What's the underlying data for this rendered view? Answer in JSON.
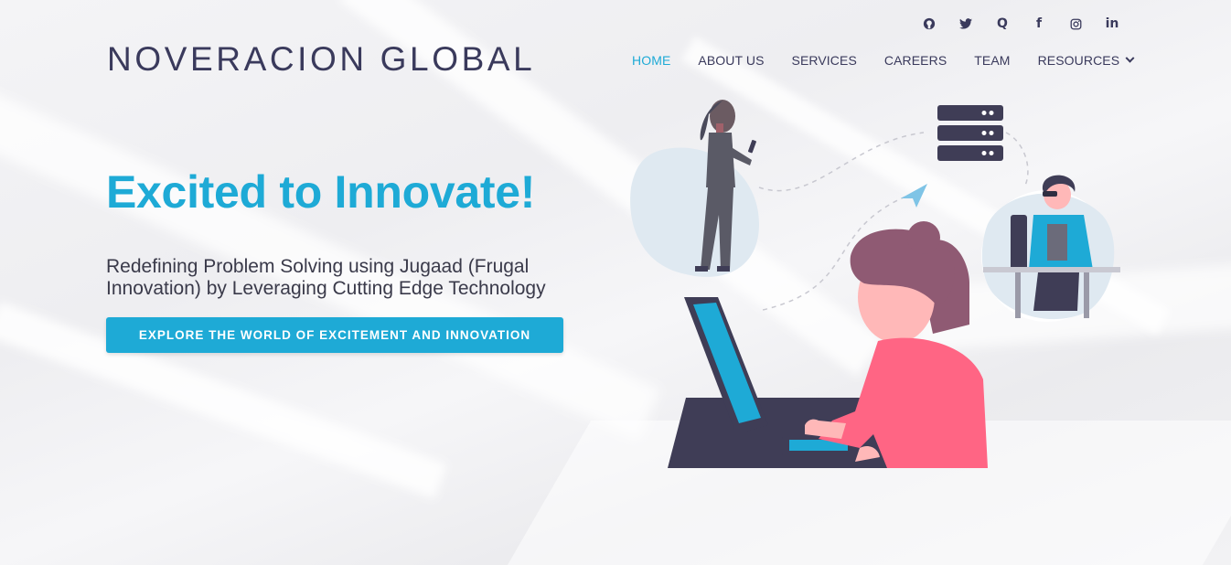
{
  "brand": {
    "logo_text": "NOVERACION GLOBAL"
  },
  "social": [
    {
      "icon": "github-icon",
      "glyph": "◉"
    },
    {
      "icon": "twitter-icon",
      "glyph": "🐦"
    },
    {
      "icon": "quora-icon",
      "glyph": "Q"
    },
    {
      "icon": "facebook-icon",
      "glyph": "f"
    },
    {
      "icon": "instagram-icon",
      "glyph": "◎"
    },
    {
      "icon": "linkedin-icon",
      "glyph": "in"
    }
  ],
  "nav": {
    "home": "HOME",
    "about": "ABOUT US",
    "services": "SERVICES",
    "careers": "CAREERS",
    "team": "TEAM",
    "resources": "RESOURCES"
  },
  "hero": {
    "headline": "Excited to Innovate!",
    "subtitle": "Redefining Problem Solving using Jugaad (Frugal Innovation) by Leveraging Cutting Edge Technology",
    "cta": "EXPLORE THE WORLD OF EXCITEMENT AND INNOVATION"
  },
  "colors": {
    "accent": "#1eaad6",
    "text_dark": "#3a3a5c",
    "pink": "#ff6584",
    "hair": "#8f5a73",
    "navy": "#3f3d56"
  }
}
